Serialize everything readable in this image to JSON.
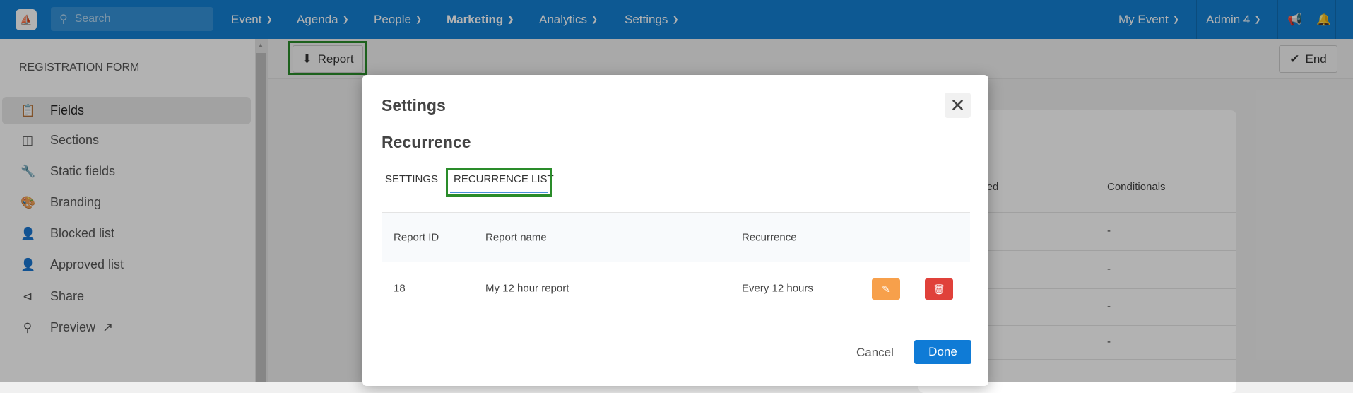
{
  "topbar": {
    "search_placeholder": "Search",
    "nav": [
      {
        "label": "Event"
      },
      {
        "label": "Agenda"
      },
      {
        "label": "People"
      },
      {
        "label": "Marketing"
      },
      {
        "label": "Analytics"
      },
      {
        "label": "Settings"
      }
    ],
    "event_selector": "My Event",
    "user": "Admin 4"
  },
  "sidebar": {
    "title": "REGISTRATION FORM",
    "items": [
      {
        "label": "Fields",
        "icon": "clipboard-list-icon",
        "active": true
      },
      {
        "label": "Sections",
        "icon": "columns-icon"
      },
      {
        "label": "Static fields",
        "icon": "wrench-icon"
      },
      {
        "label": "Branding",
        "icon": "palette-icon"
      },
      {
        "label": "Blocked list",
        "icon": "user-x-icon"
      },
      {
        "label": "Approved list",
        "icon": "user-check-icon"
      },
      {
        "label": "Share",
        "icon": "share-icon"
      },
      {
        "label": "Preview",
        "icon": "search-icon"
      }
    ]
  },
  "toolbar": {
    "report_label": "Report",
    "end_label": "End"
  },
  "background_table": {
    "headers": [
      "uired",
      "Conditionals"
    ],
    "rows": [
      "-",
      "-",
      "-",
      "-"
    ]
  },
  "modal": {
    "title": "Settings",
    "subtitle": "Recurrence",
    "tabs": [
      {
        "label": "SETTINGS"
      },
      {
        "label": "RECURRENCE LIST",
        "active": true
      }
    ],
    "columns": [
      "Report ID",
      "Report name",
      "Recurrence"
    ],
    "rows": [
      {
        "id": "18",
        "name": "My 12 hour report",
        "recurrence": "Every 12 hours"
      }
    ],
    "cancel_label": "Cancel",
    "done_label": "Done"
  },
  "colors": {
    "primary": "#1380d3",
    "edit": "#f7a04b",
    "delete": "#e0413a",
    "highlight": "#2a8c2a"
  }
}
